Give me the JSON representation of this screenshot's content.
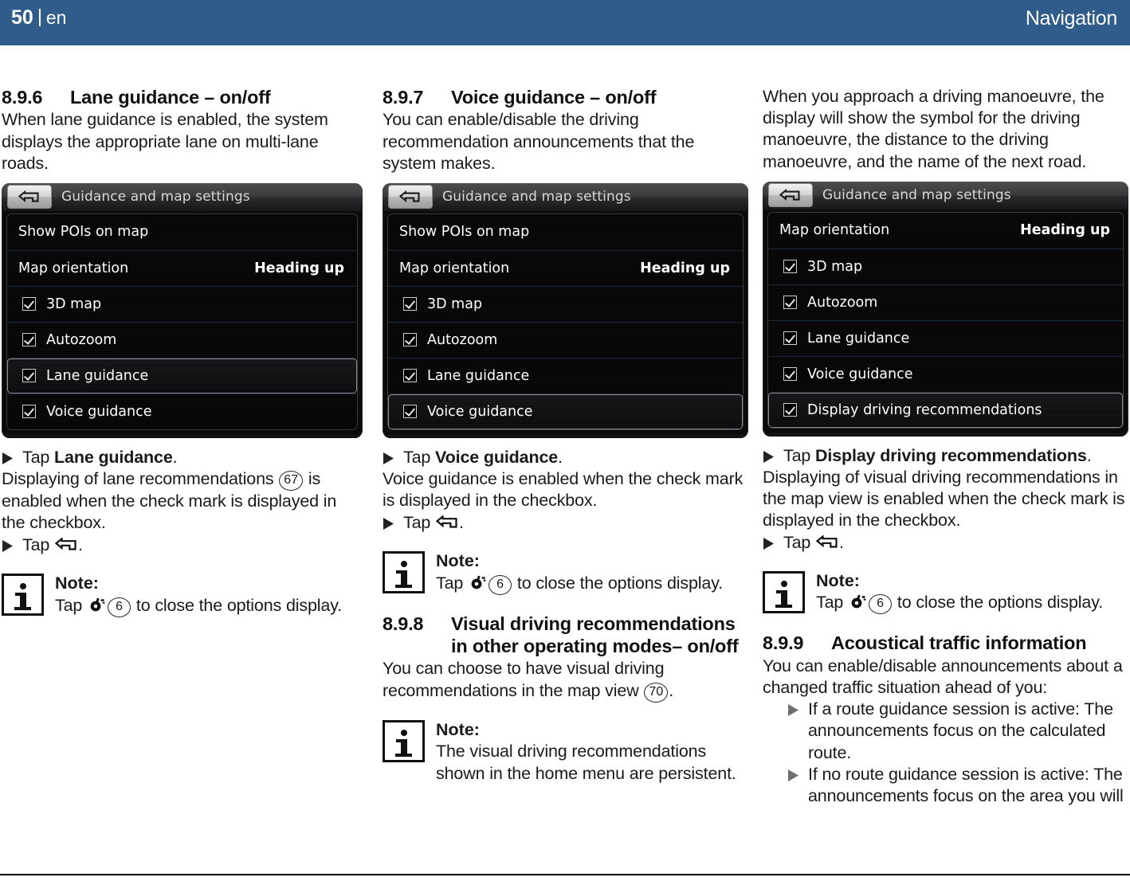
{
  "header": {
    "page_number": "50",
    "language": "en",
    "chapter": "Navigation"
  },
  "columns": {
    "col1": {
      "section": {
        "number": "8.9.6",
        "title": "Lane guidance – on/off"
      },
      "intro": "When lane guidance is enabled, the system displays the appropriate lane on multi-lane roads.",
      "device": {
        "title": "Guidance and map settings",
        "rows": [
          {
            "type": "plain",
            "label": "Show POIs on map",
            "value": ""
          },
          {
            "type": "value",
            "label": "Map orientation",
            "value": "Heading up"
          },
          {
            "type": "check",
            "label": "3D map",
            "checked": true
          },
          {
            "type": "check",
            "label": "Autozoom",
            "checked": true
          },
          {
            "type": "check",
            "label": "Lane guidance",
            "checked": true,
            "selected": true
          },
          {
            "type": "check",
            "label": "Voice guidance",
            "checked": true
          }
        ],
        "scrollbar_position": "top"
      },
      "step1_pre": "Tap ",
      "step1_bold": "Lane guidance",
      "step1_post": ".",
      "para_a": "Displaying of lane recommendations ",
      "para_a_ref": "67",
      "para_a_post": " is enabled when the check mark is displayed in the checkbox.",
      "step2_pre": "Tap ",
      "step2_post": ".",
      "note": {
        "title": "Note:",
        "pre": "Tap ",
        "ref": "6",
        "post": " to close the options display."
      }
    },
    "col2": {
      "section": {
        "number": "8.9.7",
        "title": "Voice guidance – on/off"
      },
      "intro": "You can enable/disable the driving recommendation announcements that the system makes.",
      "device": {
        "title": "Guidance and map settings",
        "rows": [
          {
            "type": "plain",
            "label": "Show POIs on map",
            "value": ""
          },
          {
            "type": "value",
            "label": "Map orientation",
            "value": "Heading up"
          },
          {
            "type": "check",
            "label": "3D map",
            "checked": true
          },
          {
            "type": "check",
            "label": "Autozoom",
            "checked": true
          },
          {
            "type": "check",
            "label": "Lane guidance",
            "checked": true
          },
          {
            "type": "check",
            "label": "Voice guidance",
            "checked": true,
            "selected": true
          }
        ],
        "scrollbar_position": "top"
      },
      "step1_pre": "Tap ",
      "step1_bold": "Voice guidance",
      "step1_post": ".",
      "para_a": "Voice guidance is enabled when the check mark is displayed in the checkbox.",
      "step2_pre": "Tap ",
      "step2_post": ".",
      "note1": {
        "title": "Note:",
        "pre": "Tap ",
        "ref": "6",
        "post": " to close the options display."
      },
      "section2": {
        "number": "8.9.8",
        "title": "Visual driving recommendations in other operating modes– on/off"
      },
      "para_b_pre": "You can choose to have visual driving recommendations in the map view ",
      "para_b_ref": "70",
      "para_b_post": ".",
      "note2": {
        "title": "Note:",
        "text": "The visual driving recommendations shown in the home menu are persistent."
      }
    },
    "col3": {
      "intro": "When you approach a driving manoeuvre, the display will show the symbol for the driving manoeuvre, the distance to the driving manoeuvre, and the name of the next road.",
      "device": {
        "title": "Guidance and map settings",
        "rows": [
          {
            "type": "value",
            "label": "Map orientation",
            "value": "Heading up"
          },
          {
            "type": "check",
            "label": "3D map",
            "checked": true
          },
          {
            "type": "check",
            "label": "Autozoom",
            "checked": true
          },
          {
            "type": "check",
            "label": "Lane guidance",
            "checked": true
          },
          {
            "type": "check",
            "label": "Voice guidance",
            "checked": true
          },
          {
            "type": "check",
            "label": "Display driving recommendations",
            "checked": true,
            "selected": true
          }
        ],
        "scrollbar_position": "middle"
      },
      "step1_pre": "Tap ",
      "step1_bold": "Display driving recommendations",
      "step1_post": ".",
      "para_a": "Displaying of visual driving recommendations in the map view is enabled when the check mark is displayed in the checkbox.",
      "step2_pre": "Tap ",
      "step2_post": ".",
      "note": {
        "title": "Note:",
        "pre": "Tap ",
        "ref": "6",
        "post": " to close the options display."
      },
      "section2": {
        "number": "8.9.9",
        "title": "Acoustical traffic information"
      },
      "para_b": "You can enable/disable announcements about a changed traffic situation ahead of you:",
      "bullet1": "If a route guidance session is active: The announcements focus on the calculated route.",
      "bullet2": "If no route guidance session is active: The announcements focus on the area you will"
    }
  },
  "colors": {
    "header_blue": "#2f5c8a",
    "text_black": "#1a1a1a",
    "device_black": "#060607",
    "scroll_blue": "#1d8ed6"
  }
}
